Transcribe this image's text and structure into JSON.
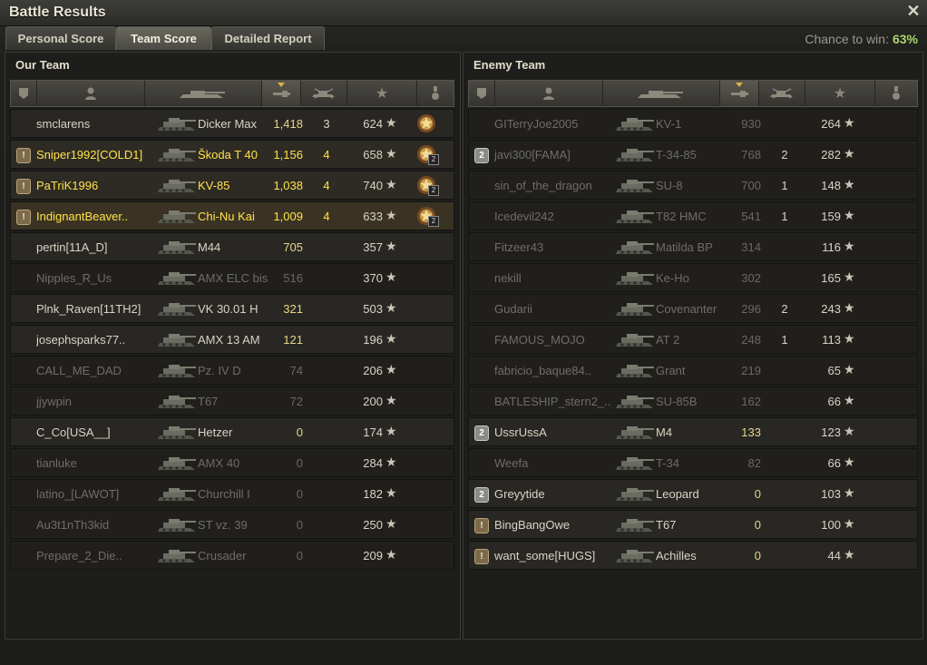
{
  "window": {
    "title": "Battle Results"
  },
  "tabs": [
    {
      "label": "Personal Score"
    },
    {
      "label": "Team Score"
    },
    {
      "label": "Detailed Report"
    }
  ],
  "chance": {
    "label": "Chance to win:",
    "value": "63%"
  },
  "our_team": {
    "title": "Our Team",
    "rows": [
      {
        "player": "smclarens",
        "tank": "Dicker Max",
        "damage": "1,418",
        "kills": "3",
        "xp": "624",
        "medal": true,
        "medal_count": "",
        "badge": "",
        "style": "light"
      },
      {
        "player": "Sniper1992[COLD1]",
        "tank": "Škoda T 40",
        "damage": "1,156",
        "kills": "4",
        "xp": "658",
        "medal": true,
        "medal_count": "2",
        "badge": "!",
        "style": "yellow"
      },
      {
        "player": "PaTriK1996",
        "tank": "KV-85",
        "damage": "1,038",
        "kills": "4",
        "xp": "740",
        "medal": true,
        "medal_count": "2",
        "badge": "!",
        "style": "yellow"
      },
      {
        "player": "IndignantBeaver..",
        "tank": "Chi-Nu Kai",
        "damage": "1,009",
        "kills": "4",
        "xp": "633",
        "medal": true,
        "medal_count": "2",
        "badge": "!",
        "style": "yellow"
      },
      {
        "player": "pertin[11A_D]",
        "tank": "M44",
        "damage": "705",
        "kills": "",
        "xp": "357",
        "medal": false,
        "badge": "",
        "style": "light"
      },
      {
        "player": "Nipples_R_Us",
        "tank": "AMX ELC bis",
        "damage": "516",
        "kills": "",
        "xp": "370",
        "medal": false,
        "badge": "",
        "style": "dim"
      },
      {
        "player": "Plnk_Raven[11TH2]",
        "tank": "VK 30.01 H",
        "damage": "321",
        "kills": "",
        "xp": "503",
        "medal": false,
        "badge": "",
        "style": "light"
      },
      {
        "player": "josephsparks77..",
        "tank": "AMX 13 AM",
        "damage": "121",
        "kills": "",
        "xp": "196",
        "medal": false,
        "badge": "",
        "style": "light"
      },
      {
        "player": "CALL_ME_DAD",
        "tank": "Pz. IV D",
        "damage": "74",
        "kills": "",
        "xp": "206",
        "medal": false,
        "badge": "",
        "style": "dim"
      },
      {
        "player": "jjywpin",
        "tank": "T67",
        "damage": "72",
        "kills": "",
        "xp": "200",
        "medal": false,
        "badge": "",
        "style": "dim"
      },
      {
        "player": "C_Co[USA__]",
        "tank": "Hetzer",
        "damage": "0",
        "kills": "",
        "xp": "174",
        "medal": false,
        "badge": "",
        "style": "light"
      },
      {
        "player": "tianluke",
        "tank": "AMX 40",
        "damage": "0",
        "kills": "",
        "xp": "284",
        "medal": false,
        "badge": "",
        "style": "dim"
      },
      {
        "player": "latino_[LAWOT]",
        "tank": "Churchill I",
        "damage": "0",
        "kills": "",
        "xp": "182",
        "medal": false,
        "badge": "",
        "style": "dim"
      },
      {
        "player": "Au3t1nTh3kid",
        "tank": "ST vz. 39",
        "damage": "0",
        "kills": "",
        "xp": "250",
        "medal": false,
        "badge": "",
        "style": "dim"
      },
      {
        "player": "Prepare_2_Die..",
        "tank": "Crusader",
        "damage": "0",
        "kills": "",
        "xp": "209",
        "medal": false,
        "badge": "",
        "style": "dim"
      }
    ]
  },
  "enemy_team": {
    "title": "Enemy Team",
    "rows": [
      {
        "player": "GITerryJoe2005",
        "tank": "KV-1",
        "damage": "930",
        "kills": "",
        "xp": "264",
        "badge": "",
        "style": "dim"
      },
      {
        "player": "javi300[FAMA]",
        "tank": "T-34-85",
        "damage": "768",
        "kills": "2",
        "xp": "282",
        "badge": "2",
        "style": "dim"
      },
      {
        "player": "sin_of_the_dragon",
        "tank": "SU-8",
        "damage": "700",
        "kills": "1",
        "xp": "148",
        "badge": "",
        "style": "dim"
      },
      {
        "player": "Icedevil242",
        "tank": "T82 HMC",
        "damage": "541",
        "kills": "1",
        "xp": "159",
        "badge": "",
        "style": "dim"
      },
      {
        "player": "Fitzeer43",
        "tank": "Matilda BP",
        "damage": "314",
        "kills": "",
        "xp": "116",
        "badge": "",
        "style": "dim"
      },
      {
        "player": "nekill",
        "tank": "Ke-Ho",
        "damage": "302",
        "kills": "",
        "xp": "165",
        "badge": "",
        "style": "dim"
      },
      {
        "player": "Gudarii",
        "tank": "Covenanter",
        "damage": "296",
        "kills": "2",
        "xp": "243",
        "badge": "",
        "style": "dim"
      },
      {
        "player": "FAMOUS_MOJO",
        "tank": "AT 2",
        "damage": "248",
        "kills": "1",
        "xp": "113",
        "badge": "",
        "style": "dim"
      },
      {
        "player": "fabricio_baque84..",
        "tank": "Grant",
        "damage": "219",
        "kills": "",
        "xp": "65",
        "badge": "",
        "style": "dim"
      },
      {
        "player": "BATLESHIP_stern2_..",
        "tank": "SU-85B",
        "damage": "162",
        "kills": "",
        "xp": "66",
        "badge": "",
        "style": "dim"
      },
      {
        "player": "UssrUssA",
        "tank": "M4",
        "damage": "133",
        "kills": "",
        "xp": "123",
        "badge": "2",
        "style": "light"
      },
      {
        "player": "Weefa",
        "tank": "T-34",
        "damage": "82",
        "kills": "",
        "xp": "66",
        "badge": "",
        "style": "dim"
      },
      {
        "player": "Greyytide",
        "tank": "Leopard",
        "damage": "0",
        "kills": "",
        "xp": "103",
        "badge": "2",
        "style": "light"
      },
      {
        "player": "BingBangOwe",
        "tank": "T67",
        "damage": "0",
        "kills": "",
        "xp": "100",
        "badge": "!",
        "style": "light"
      },
      {
        "player": "want_some[HUGS]",
        "tank": "Achilles",
        "damage": "0",
        "kills": "",
        "xp": "44",
        "badge": "!",
        "style": "light"
      }
    ]
  },
  "icons": {
    "close": "close-icon",
    "star": "★",
    "colors": {
      "accent_yellow": "#ffe24a",
      "chance_green": "#a9d46a"
    }
  }
}
